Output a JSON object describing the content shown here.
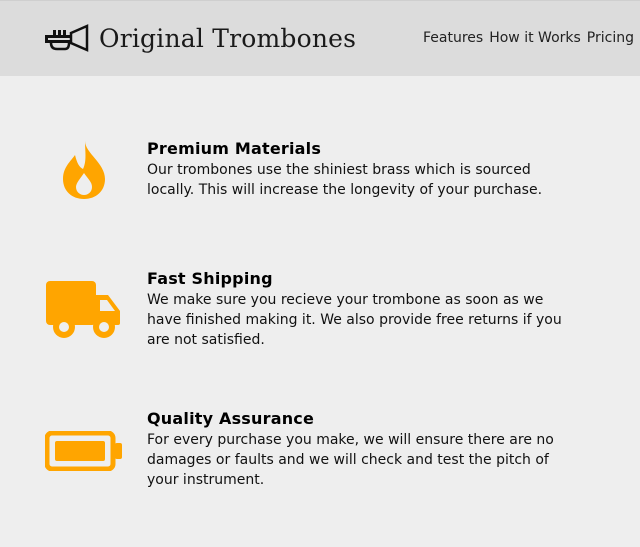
{
  "brand": {
    "name": "Original Trombones",
    "logo_icon": "trumpet-icon",
    "accent_color": "#ffa500"
  },
  "nav": {
    "items": [
      {
        "label": "Features"
      },
      {
        "label": "How it Works"
      },
      {
        "label": "Pricing"
      }
    ]
  },
  "features": [
    {
      "icon": "fire-icon",
      "title": "Premium Materials",
      "description": "Our trombones use the shiniest brass which is sourced locally. This will increase the longevity of your purchase."
    },
    {
      "icon": "truck-icon",
      "title": "Fast Shipping",
      "description": "We make sure you recieve your trombone as soon as we have finished making it. We also provide free returns if you are not satisfied."
    },
    {
      "icon": "battery-icon",
      "title": "Quality Assurance",
      "description": "For every purchase you make, we will ensure there are no damages or faults and we will check and test the pitch of your instrument."
    }
  ]
}
